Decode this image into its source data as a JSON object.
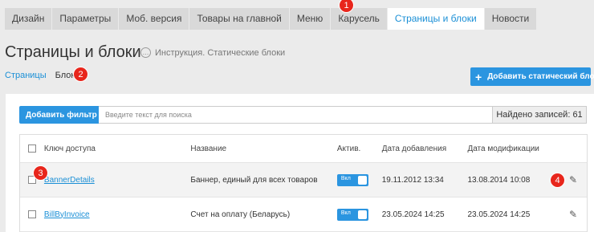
{
  "tabs": [
    {
      "label": "Дизайн"
    },
    {
      "label": "Параметры"
    },
    {
      "label": "Моб. версия"
    },
    {
      "label": "Товары на главной"
    },
    {
      "label": "Меню"
    },
    {
      "label": "Карусель"
    },
    {
      "label": "Страницы и блоки",
      "active": true
    },
    {
      "label": "Новости"
    }
  ],
  "page": {
    "title": "Страницы и блоки",
    "help_label": "Инструкция. Статические блоки"
  },
  "subnav": {
    "pages_label": "Страницы",
    "blocks_label": "Блоки"
  },
  "add_static_label": "Добавить статический блок",
  "filter": {
    "add_filter_label": "Добавить фильтр",
    "search_placeholder": "Введите текст для поиска",
    "found_label": "Найдено записей: 61"
  },
  "table": {
    "headers": {
      "key": "Ключ доступа",
      "name": "Название",
      "active": "Актив.",
      "added": "Дата добавления",
      "modified": "Дата модификации"
    },
    "rows": [
      {
        "key": "BannerDetails",
        "name": "Баннер, единый для всех товаров",
        "toggle": "Вкл",
        "added": "19.11.2012 13:34",
        "modified": "13.08.2014 10:08"
      },
      {
        "key": "BillByInvoice",
        "name": "Счет на оплату (Беларусь)",
        "toggle": "Вкл",
        "added": "23.05.2024 14:25",
        "modified": "23.05.2024 14:25"
      }
    ]
  },
  "badges": [
    "1",
    "2",
    "3",
    "4"
  ],
  "colors": {
    "accent": "#2b95e0",
    "link": "#1a8fd6",
    "badge": "#e8261c"
  }
}
